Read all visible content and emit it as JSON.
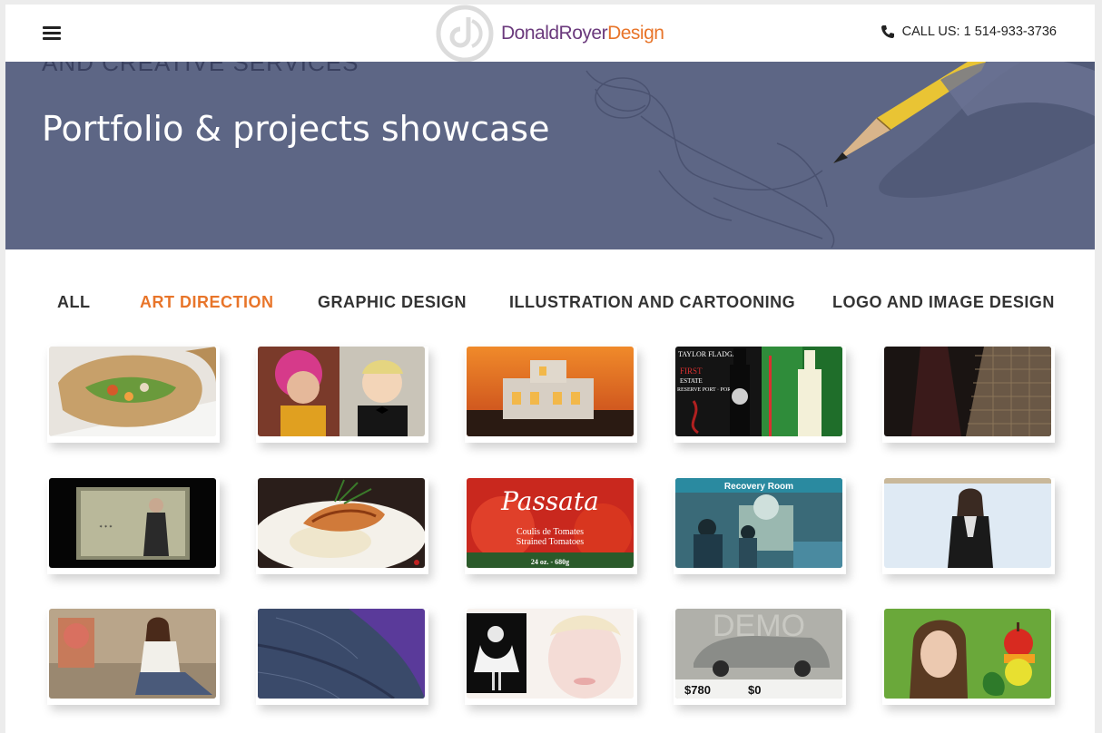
{
  "header": {
    "logo_name_part1": "DonaldRoyer",
    "logo_name_part2": "Design",
    "call_label": "CALL US: 1 514-933-3736"
  },
  "hero": {
    "subtitle": "AND CREATIVE SERVICES",
    "title": "Portfolio & projects showcase"
  },
  "tabs": [
    {
      "label": "ALL",
      "active": false
    },
    {
      "label": "ART DIRECTION",
      "active": true
    },
    {
      "label": "GRAPHIC DESIGN",
      "active": false
    },
    {
      "label": "ILLUSTRATION AND CARTOONING",
      "active": false
    },
    {
      "label": "LOGO AND IMAGE DESIGN",
      "active": false
    }
  ],
  "thumb_text": {
    "wine_brand": "TAYLOR FLADGATE",
    "wine_label1": "FIRST",
    "wine_label2": "ESTATE",
    "wine_label3": "RESERVE PORT · PORTO",
    "passata_brand": "Passata",
    "passata_line1": "Coulis de Tomates",
    "passata_line2": "Strained Tomatoes",
    "passata_weight": "24 oz. - 680g",
    "recovery_title": "Recovery Room",
    "demo_word": "DEMO",
    "car_price1": "$780",
    "car_price2": "$0"
  },
  "colors": {
    "accent": "#e8752a",
    "brand_purple": "#6b3a7d",
    "hero_bg": "#5d6685"
  }
}
